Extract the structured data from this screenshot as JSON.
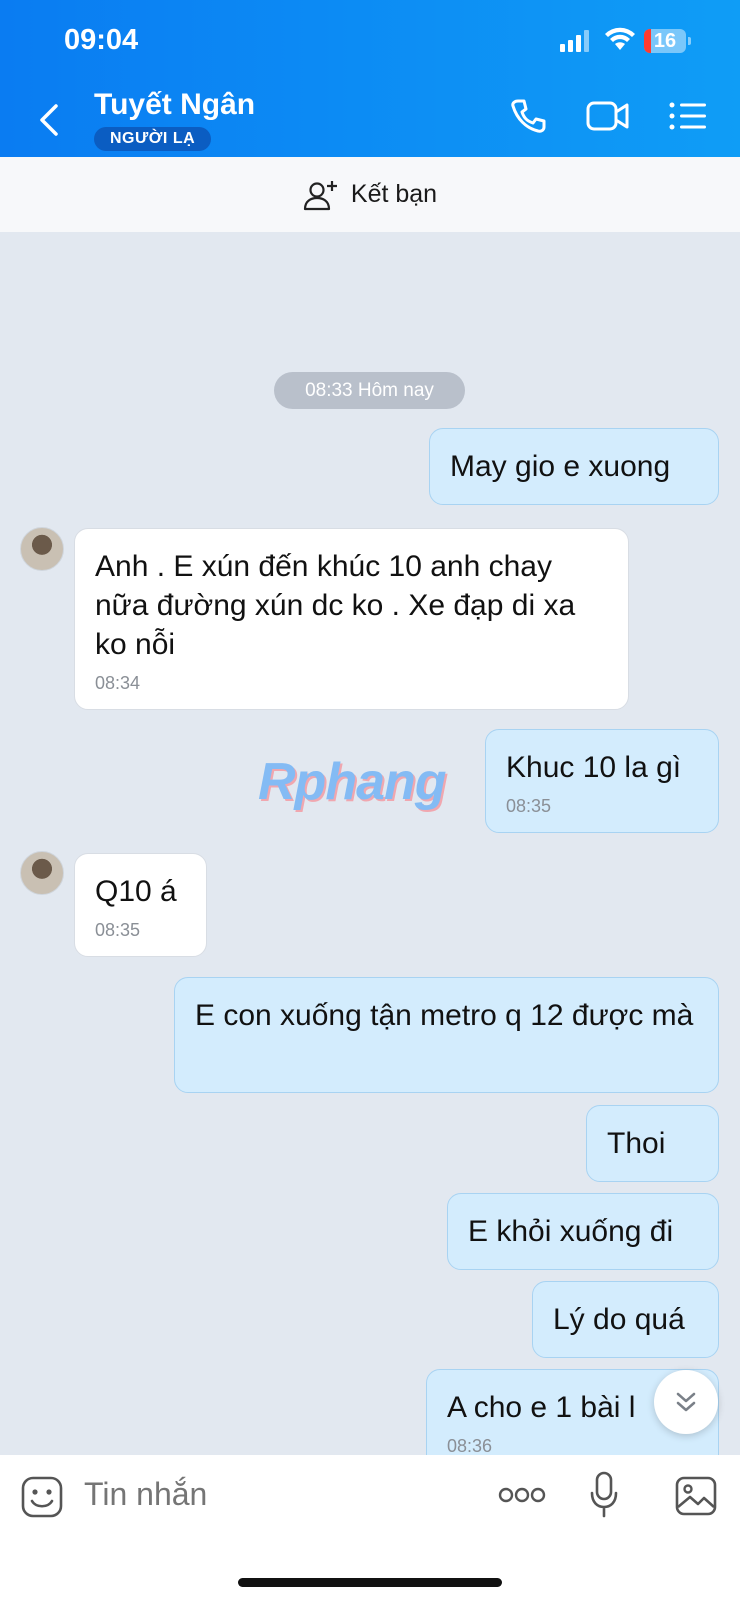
{
  "status": {
    "time": "09:04",
    "battery": "16",
    "battery_level": 0.16
  },
  "header": {
    "contact_name": "Tuyết Ngân",
    "contact_badge": "NGƯỜI LẠ"
  },
  "friend_bar": {
    "label": "Kết bạn"
  },
  "chat": {
    "date_separator": "08:33 Hôm nay",
    "messages": [
      {
        "dir": "out",
        "text": "May gio e xuong",
        "time": ""
      },
      {
        "dir": "in",
        "text": "Anh . E xún đến khúc 10 anh chay nữa đường xún dc ko . Xe đạp di xa ko nỗi",
        "time": "08:34"
      },
      {
        "dir": "out",
        "text": "Khuc 10 la gì",
        "time": "08:35"
      },
      {
        "dir": "in",
        "text": "Q10 á",
        "time": "08:35"
      },
      {
        "dir": "out",
        "text": "E con xuống tận metro q 12 được mà",
        "time": ""
      },
      {
        "dir": "out",
        "text": "Thoi",
        "time": ""
      },
      {
        "dir": "out",
        "text": "E khỏi xuống đi",
        "time": ""
      },
      {
        "dir": "out",
        "text": "Lý do quá",
        "time": ""
      },
      {
        "dir": "out",
        "text": "A cho e 1 bài l",
        "time": "08:36"
      }
    ],
    "watermark": "Rphang"
  },
  "composer": {
    "placeholder": "Tin nhắn"
  },
  "colors": {
    "header": "#0a7cf2",
    "outgoing_bubble": "#d3ecfd",
    "incoming_bubble": "#ffffff",
    "chat_bg": "#e2e8f0"
  }
}
